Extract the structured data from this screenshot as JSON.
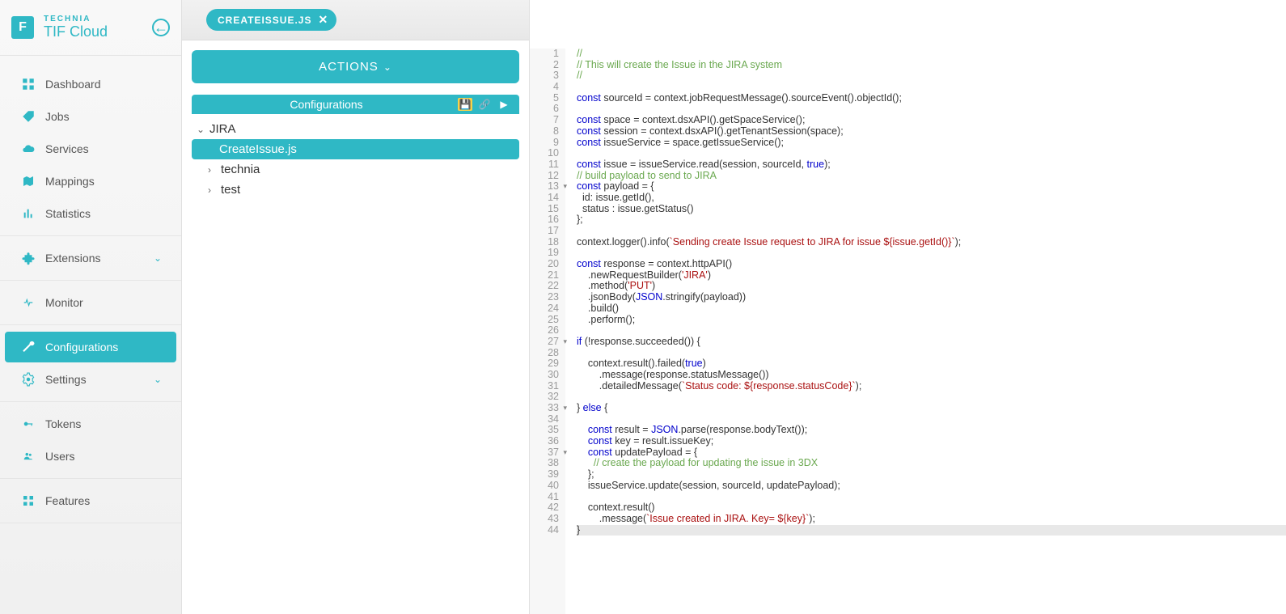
{
  "brand": {
    "small": "TECHNIA",
    "big": "TIF Cloud"
  },
  "nav": {
    "dashboard": "Dashboard",
    "jobs": "Jobs",
    "services": "Services",
    "mappings": "Mappings",
    "statistics": "Statistics",
    "extensions": "Extensions",
    "monitor": "Monitor",
    "configurations": "Configurations",
    "settings": "Settings",
    "tokens": "Tokens",
    "users": "Users",
    "features": "Features"
  },
  "tab": {
    "name": "CREATEISSUE.JS"
  },
  "mid": {
    "actions": "ACTIONS",
    "panelTitle": "Configurations",
    "tree": {
      "jira": "JIRA",
      "createIssue": "CreateIssue.js",
      "technia": "technia",
      "test": "test"
    }
  },
  "code": {
    "foldLines": [
      13,
      27,
      33,
      37
    ],
    "cursorLine": 44,
    "lines": [
      {
        "n": 1,
        "h": "<span class='cm'>//</span>"
      },
      {
        "n": 2,
        "h": "<span class='cm'>// This will create the Issue in the JIRA system</span>"
      },
      {
        "n": 3,
        "h": "<span class='cm'>//</span>"
      },
      {
        "n": 4,
        "h": ""
      },
      {
        "n": 5,
        "h": "<span class='kw'>const</span> sourceId = context.jobRequestMessage().sourceEvent().objectId();"
      },
      {
        "n": 6,
        "h": ""
      },
      {
        "n": 7,
        "h": "<span class='kw'>const</span> space = context.dsxAPI().getSpaceService();"
      },
      {
        "n": 8,
        "h": "<span class='kw'>const</span> session = context.dsxAPI().getTenantSession(space);"
      },
      {
        "n": 9,
        "h": "<span class='kw'>const</span> issueService = space.getIssueService();"
      },
      {
        "n": 10,
        "h": ""
      },
      {
        "n": 11,
        "h": "<span class='kw'>const</span> issue = issueService.read(session, sourceId, <span class='lit'>true</span>);"
      },
      {
        "n": 12,
        "h": "<span class='cm'>// build payload to send to JIRA</span>"
      },
      {
        "n": 13,
        "h": "<span class='kw'>const</span> payload = {"
      },
      {
        "n": 14,
        "h": "  id: issue.getId(),"
      },
      {
        "n": 15,
        "h": "  status : issue.getStatus()"
      },
      {
        "n": 16,
        "h": "};"
      },
      {
        "n": 17,
        "h": ""
      },
      {
        "n": 18,
        "h": "context.logger().info(<span class='str'>`Sending create Issue request to JIRA for issue ${issue.getId()}`</span>);"
      },
      {
        "n": 19,
        "h": ""
      },
      {
        "n": 20,
        "h": "<span class='kw'>const</span> response = context.httpAPI()"
      },
      {
        "n": 21,
        "h": "    .newRequestBuilder(<span class='str'>'JIRA'</span>)"
      },
      {
        "n": 22,
        "h": "    .method(<span class='str'>'PUT'</span>)"
      },
      {
        "n": 23,
        "h": "    .jsonBody(<span class='lit'>JSON</span>.stringify(payload))"
      },
      {
        "n": 24,
        "h": "    .build()"
      },
      {
        "n": 25,
        "h": "    .perform();"
      },
      {
        "n": 26,
        "h": ""
      },
      {
        "n": 27,
        "h": "<span class='kw'>if</span> (!response.succeeded()) {"
      },
      {
        "n": 28,
        "h": ""
      },
      {
        "n": 29,
        "h": "    context.result().failed(<span class='lit'>true</span>)"
      },
      {
        "n": 30,
        "h": "        .message(response.statusMessage())"
      },
      {
        "n": 31,
        "h": "        .detailedMessage(<span class='str'>`Status code: ${response.statusCode}`</span>);"
      },
      {
        "n": 32,
        "h": ""
      },
      {
        "n": 33,
        "h": "} <span class='kw'>else</span> {"
      },
      {
        "n": 34,
        "h": ""
      },
      {
        "n": 35,
        "h": "    <span class='kw'>const</span> result = <span class='lit'>JSON</span>.parse(response.bodyText());"
      },
      {
        "n": 36,
        "h": "    <span class='kw'>const</span> key = result.issueKey;"
      },
      {
        "n": 37,
        "h": "    <span class='kw'>const</span> updatePayload = {"
      },
      {
        "n": 38,
        "h": "      <span class='cm'>// create the payload for updating the issue in 3DX</span>"
      },
      {
        "n": 39,
        "h": "    };"
      },
      {
        "n": 40,
        "h": "    issueService.update(session, sourceId, updatePayload);"
      },
      {
        "n": 41,
        "h": ""
      },
      {
        "n": 42,
        "h": "    context.result()"
      },
      {
        "n": 43,
        "h": "        .message(<span class='str'>`Issue created in JIRA. Key= ${key}`</span>);"
      },
      {
        "n": 44,
        "h": "}"
      }
    ]
  }
}
